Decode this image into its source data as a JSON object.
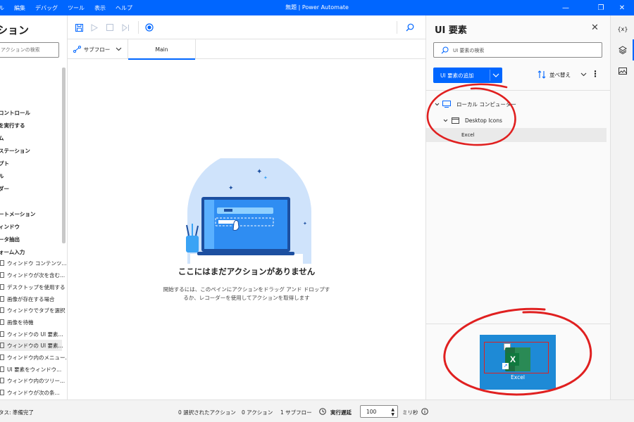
{
  "titlebar": {
    "menus": [
      "ル",
      "編集",
      "デバッグ",
      "ツール",
      "表示",
      "ヘルプ"
    ],
    "title": "無題 | Power Automate",
    "minimize": "—",
    "restore": "❐",
    "close": "✕"
  },
  "left_panel": {
    "title": "ション",
    "search_placeholder": "アクションの検索",
    "groups": [
      "コントロール",
      "を実行する",
      "ム",
      "ステーション",
      "プト",
      "ル",
      "ダー",
      "ートメーション",
      "ィンドウ",
      "ータ抽出",
      "ォーム入力"
    ],
    "items": [
      "ウィンドウ コンテンツ...",
      "ウィンドウが次を含む...",
      "デスクトップを使用する",
      "画像が存在する場合",
      "ウィンドウでタブを選択",
      "画像を待機",
      "ウィンドウの UI 要素...",
      "ウィンドウの UI 要素...",
      "ウィンドウ内のメニュー...",
      "UI 要素をウィンドウ...",
      "ウィンドウ内のツリー...",
      "ウィンドウが次の条..."
    ]
  },
  "toolbar": {
    "search_icon": "search-icon"
  },
  "tabs": {
    "subflow_label": "サブフロー",
    "main_label": "Main"
  },
  "canvas": {
    "empty_title": "ここにはまだアクションがありません",
    "empty_desc": "開始するには、このペインにアクションをドラッグ アンド ドロップするか、レコーダーを使用してアクションを取得します"
  },
  "ui_panel": {
    "title": "UI 要素",
    "search_placeholder": "UI 要素の検索",
    "add_button": "UI 要素の追加",
    "sort_label": "並べ替え",
    "tree": {
      "root": "ローカル コンピューター",
      "child": "Desktop Icons",
      "leaf": "Excel"
    },
    "preview_label": "Excel",
    "preview_icon_letter": "X"
  },
  "rail": {
    "variables": "{x}"
  },
  "statusbar": {
    "status": "タス: 準備完了",
    "selected_actions": "0 選択されたアクション",
    "actions": "0 アクション",
    "subflows": "1 サブフロー",
    "delay_label": "実行遅延",
    "delay_value": "100",
    "delay_unit": "ミリ秒"
  },
  "colors": {
    "accent": "#0066ff",
    "annotation_red": "#e02020",
    "excel_green": "#1d6f42"
  }
}
